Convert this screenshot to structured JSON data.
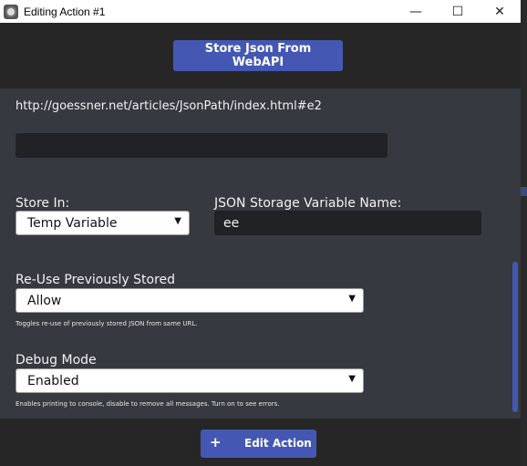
{
  "window": {
    "title": "Editing Action #1",
    "minimize": "—",
    "maximize": "☐",
    "close": "✕"
  },
  "header": {
    "store_button": "Store Json From WebAPI"
  },
  "content": {
    "url": "http://goessner.net/articles/JsonPath/index.html#e2",
    "store_in": {
      "label": "Store In:",
      "value": "Temp Variable"
    },
    "var_name": {
      "label": "JSON Storage Variable Name:",
      "value": "ee"
    },
    "reuse": {
      "label": "Re-Use Previously Stored",
      "value": "Allow",
      "hint": "Toggles re-use of previously stored JSON from same URL."
    },
    "debug": {
      "label": "Debug Mode",
      "value": "Enabled",
      "hint": "Enables printing to console, disable to remove all messages. Turn on to see errors."
    }
  },
  "footer": {
    "edit_button": "Edit Action",
    "plus": "+"
  },
  "icons": {
    "dropdown": "▼"
  },
  "colors": {
    "accent": "#4458b3",
    "panel": "#36393f",
    "header": "#262626"
  }
}
